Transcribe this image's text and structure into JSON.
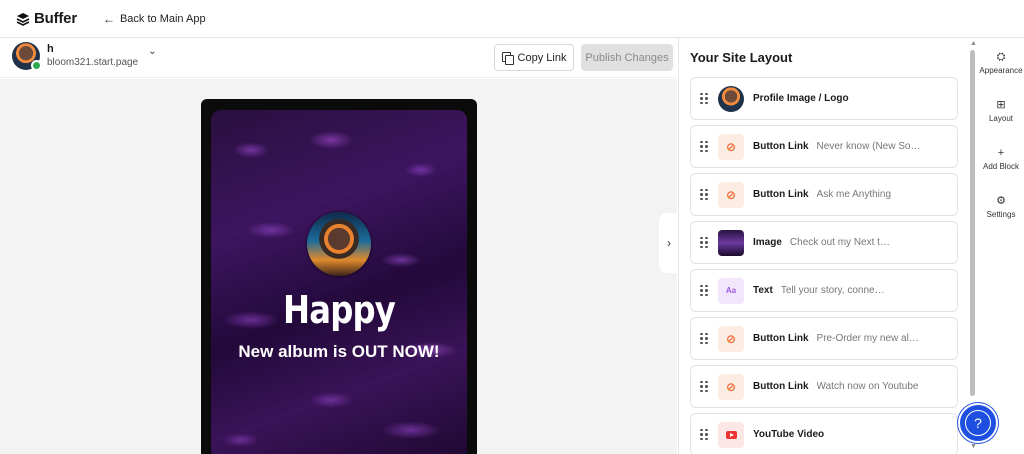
{
  "header": {
    "brand": "Buffer",
    "back_label": "Back to Main App"
  },
  "account": {
    "name": "h",
    "url": "bloom321.start.page"
  },
  "toolbar": {
    "copy_label": "Copy Link",
    "publish_label": "Publish Changes"
  },
  "preview": {
    "title": "Happy",
    "subtitle": "New album is OUT NOW!"
  },
  "panel": {
    "title": "Your Site Layout",
    "blocks": [
      {
        "type": "Profile Image / Logo",
        "desc": "",
        "icon": "avatar-thumbnail"
      },
      {
        "type": "Button Link",
        "desc": "Never know (New Son...",
        "icon": "link-icon"
      },
      {
        "type": "Button Link",
        "desc": "Ask me Anything",
        "icon": "link-icon"
      },
      {
        "type": "Image",
        "desc": "Check out my Next tours",
        "icon": "image-thumbnail"
      },
      {
        "type": "Text",
        "desc": "Tell your story, connect with y...",
        "icon": "text-icon",
        "glyph": "Aa"
      },
      {
        "type": "Button Link",
        "desc": "Pre-Order my new alb...",
        "icon": "link-icon"
      },
      {
        "type": "Button Link",
        "desc": "Watch now on Youtube",
        "icon": "link-icon"
      },
      {
        "type": "YouTube Video",
        "desc": "",
        "icon": "youtube-icon"
      }
    ]
  },
  "rail": {
    "appearance": "Appearance",
    "layout": "Layout",
    "add_block": "Add Block",
    "settings": "Settings"
  },
  "help": {
    "glyph": "?"
  },
  "colors": {
    "accent": "#1f4fe0",
    "link_icon": "#f0692f",
    "text_icon": "#9b59e0",
    "status_ok": "#2fa84f"
  }
}
